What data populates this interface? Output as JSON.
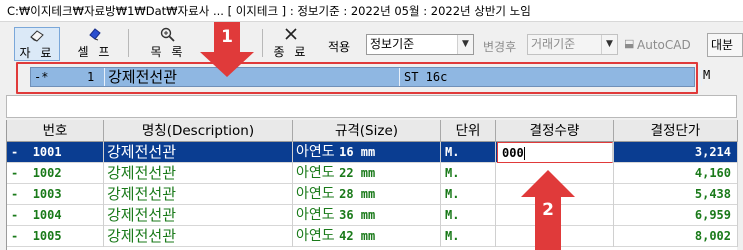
{
  "titlebar": {
    "text": "C:₩이지테크₩자료방₩1₩Dat₩자료사 ... [ 이지테크 ] : 정보기준 : 2022년 05월 : 2022년 상반기 노임"
  },
  "toolbar": {
    "buttons": [
      {
        "label": "자 료",
        "icon": "eraser-icon"
      },
      {
        "label": "셀 프",
        "icon": "diamond-icon"
      },
      {
        "label": "목 록",
        "icon": "magnifier-icon"
      },
      {
        "label": "종 료",
        "icon": "close-icon"
      }
    ],
    "apply_label": "적용",
    "apply_value": "정보기준",
    "after_label": "변경후",
    "after_value": "거래기준",
    "autocad_label": "AutoCAD",
    "big_button": "대분"
  },
  "current_record": {
    "marker": "-*",
    "number": "1",
    "name": "강제전선관",
    "spec": "ST 16c",
    "unit": "M"
  },
  "grid": {
    "columns": [
      "번호",
      "명칭(Description)",
      "규격(Size)",
      "단위",
      "결정수량",
      "결정단가"
    ],
    "rows": [
      {
        "marker": "-",
        "no": "1001",
        "name": "강제전선관",
        "spec_kr": "아연도",
        "spec_val": "16 mm",
        "unit": "M.",
        "qty": "000",
        "price": "3,214",
        "selected": true
      },
      {
        "marker": "-",
        "no": "1002",
        "name": "강제전선관",
        "spec_kr": "아연도",
        "spec_val": "22 mm",
        "unit": "M.",
        "qty": "",
        "price": "4,160",
        "selected": false
      },
      {
        "marker": "-",
        "no": "1003",
        "name": "강제전선관",
        "spec_kr": "아연도",
        "spec_val": "28 mm",
        "unit": "M.",
        "qty": "",
        "price": "5,438",
        "selected": false
      },
      {
        "marker": "-",
        "no": "1004",
        "name": "강제전선관",
        "spec_kr": "아연도",
        "spec_val": "36 mm",
        "unit": "M.",
        "qty": "",
        "price": "6,959",
        "selected": false
      },
      {
        "marker": "-",
        "no": "1005",
        "name": "강제전선관",
        "spec_kr": "아연도",
        "spec_val": "42 mm",
        "unit": "M.",
        "qty": "",
        "price": "8,002",
        "selected": false
      }
    ]
  },
  "annotations": {
    "callout_1": "1",
    "callout_2": "2",
    "color": "#e03a3a"
  },
  "colors": {
    "selected_row": "#0a3d91",
    "row_text": "#1a7a1a",
    "current_bar": "#8fb7e2"
  }
}
